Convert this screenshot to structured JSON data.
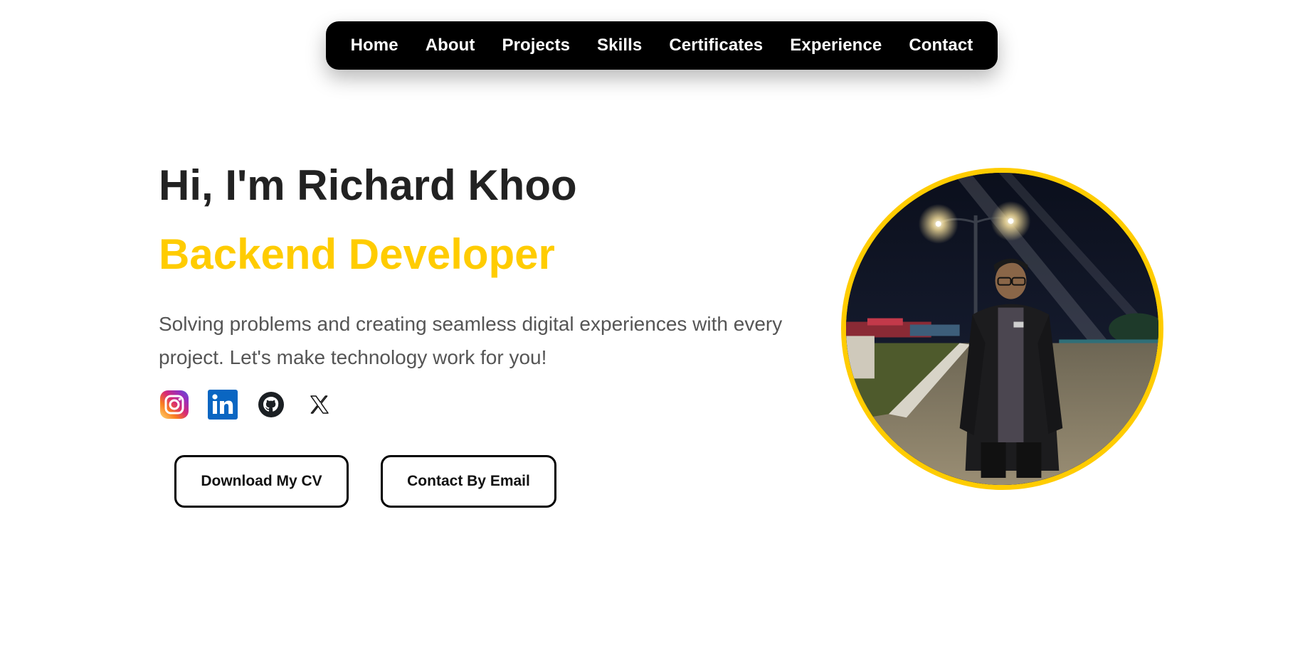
{
  "nav": {
    "items": [
      {
        "label": "Home"
      },
      {
        "label": "About"
      },
      {
        "label": "Projects"
      },
      {
        "label": "Skills"
      },
      {
        "label": "Certificates"
      },
      {
        "label": "Experience"
      },
      {
        "label": "Contact"
      }
    ]
  },
  "hero": {
    "greeting": "Hi, I'm Richard Khoo",
    "role": "Backend Developer",
    "description": "Solving problems and creating seamless digital experiences with every project. Let's make technology work for you!",
    "buttons": {
      "download_cv": "Download My CV",
      "contact_email": "Contact By Email"
    }
  },
  "socials": [
    {
      "icon": "instagram-icon"
    },
    {
      "icon": "linkedin-icon"
    },
    {
      "icon": "github-icon"
    },
    {
      "icon": "x-icon"
    }
  ],
  "colors": {
    "accent": "#FFCC00",
    "nav_bg": "#000000",
    "title": "#222222",
    "text": "#555555"
  }
}
